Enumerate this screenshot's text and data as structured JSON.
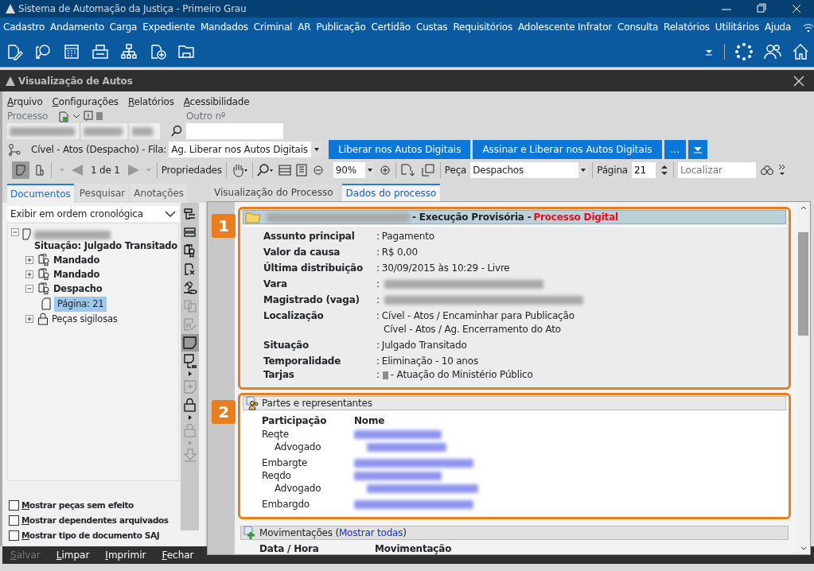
{
  "window": {
    "title": "Sistema de Automação da Justiça - Primeiro Grau"
  },
  "app_menu": [
    "Cadastro",
    "Andamento",
    "Carga",
    "Expediente",
    "Mandados",
    "Criminal",
    "AR",
    "Publicação",
    "Certidão",
    "Custas",
    "Requisitórios",
    "Adolescente Infrator",
    "Consulta",
    "Relatórios",
    "Utilitários",
    "Ajuda"
  ],
  "child_window": {
    "title": "Visualização de Autos"
  },
  "child_menu": [
    "Arquivo",
    "Configurações",
    "Relatórios",
    "Acessibilidade"
  ],
  "process_fields": {
    "processo_label": "Processo",
    "outro_label": "Outro nº"
  },
  "queue": {
    "label": "Cível - Atos (Despacho) - Fila:",
    "value": "Ag. Liberar nos Autos Digitais",
    "buttons": [
      "Liberar nos Autos Digitais",
      "Assinar e Liberar nos Autos Digitais",
      "..."
    ]
  },
  "doc_toolbar": {
    "page_counter": "1 de 1",
    "properties": "Propriedades",
    "zoom": "90%",
    "peca_label": "Peça",
    "peca_value": "Despachos",
    "pagina_label": "Página",
    "pagina_value": "21",
    "search_placeholder": "Localizar"
  },
  "left_tabs": [
    {
      "label": "Documentos",
      "selected": true
    },
    {
      "label": "Pesquisar",
      "selected": false
    },
    {
      "label": "Anotações",
      "selected": false
    }
  ],
  "order_select": "Exibir em ordem cronológica",
  "tree": {
    "status": "Situação: Julgado Transitado",
    "expanded": true,
    "children": [
      {
        "label": "Mandado",
        "kind": "seal",
        "expanded": false,
        "bold": true,
        "selected": false
      },
      {
        "label": "Mandado",
        "kind": "seal",
        "expanded": false,
        "bold": true,
        "selected": false
      },
      {
        "label": "Despacho",
        "kind": "seal",
        "expanded": true,
        "bold": true,
        "selected": false,
        "children": [
          {
            "label": "Página: 21",
            "kind": "page",
            "selected": true
          }
        ]
      },
      {
        "label": "Peças sigilosas",
        "kind": "lock",
        "expanded": false,
        "bold": false,
        "selected": false
      }
    ]
  },
  "side_tools": [
    {
      "kind": "tree",
      "disabled": false,
      "selected": false
    },
    {
      "kind": "layout",
      "disabled": false,
      "selected": false
    },
    {
      "kind": "seal",
      "disabled": false,
      "selected": false
    },
    {
      "kind": "docx",
      "disabled": false,
      "selected": false
    },
    {
      "kind": "gavel",
      "disabled": false,
      "selected": false
    },
    {
      "kind": "copy",
      "disabled": true,
      "selected": false
    },
    {
      "kind": "sign",
      "disabled": true,
      "selected": false
    },
    {
      "kind": "note",
      "disabled": false,
      "selected": true
    },
    {
      "kind": "notetree",
      "disabled": false,
      "selected": false
    },
    {
      "kind": "add",
      "disabled": true,
      "selected": false
    },
    {
      "kind": "lock",
      "disabled": false,
      "selected": false
    },
    {
      "kind": "lock",
      "disabled": true,
      "selected": false
    },
    {
      "kind": "download",
      "disabled": true,
      "selected": false
    }
  ],
  "options": [
    {
      "label": "Mostrar peças sem efeito",
      "checked": false
    },
    {
      "label": "Mostrar dependentes arquivados",
      "checked": false
    },
    {
      "label": "Mostrar tipo de documento SAJ",
      "checked": false
    }
  ],
  "bottom_buttons": [
    {
      "label": "Salvar",
      "disabled": true
    },
    {
      "label": "Limpar",
      "disabled": false
    },
    {
      "label": "Imprimir",
      "disabled": false
    },
    {
      "label": "Fechar",
      "disabled": false
    }
  ],
  "right_tabs": [
    {
      "label": "Visualização do Processo",
      "selected": false
    },
    {
      "label": "Dados do processo",
      "selected": true
    }
  ],
  "process_section": {
    "callout": "1",
    "separator": ":",
    "title": "- Execução Provisória -",
    "status": "Processo Digital",
    "fields": [
      {
        "label": "Assunto principal",
        "kind": "text",
        "values": [
          "Pagamento"
        ]
      },
      {
        "label": "Valor da causa",
        "kind": "text",
        "values": [
          "R$ 0,00"
        ]
      },
      {
        "label": "Última distribuição",
        "kind": "text",
        "values": [
          "30/09/2015 às 10:29 - Livre"
        ]
      },
      {
        "label": "Vara",
        "kind": "redacted"
      },
      {
        "label": "Magistrado (vaga)",
        "kind": "redacted"
      },
      {
        "label": "Localização",
        "kind": "text",
        "values": [
          "Cível - Atos / Encaminhar para Publicação",
          "Cível - Atos / Ag. Encerramento do Ato"
        ]
      },
      {
        "label": "Situação",
        "kind": "text",
        "values": [
          "Julgado Transitado"
        ]
      },
      {
        "label": "Temporalidade",
        "kind": "text",
        "values": [
          "Eliminação - 10 anos"
        ]
      },
      {
        "label": "Tarjas",
        "kind": "tag",
        "color": "#8c8c8c",
        "values": [
          "- Atuação do Ministério Público"
        ]
      }
    ]
  },
  "parties_section": {
    "callout": "2",
    "title": "Partes e representantes",
    "columns": [
      "Participação",
      "Nome"
    ],
    "rows": [
      {
        "role": "Reqte",
        "children": [
          {
            "role": "Advogado"
          }
        ]
      },
      {
        "role": "Embargte",
        "children": []
      },
      {
        "role": "Reqdo",
        "children": [
          {
            "role": "Advogado"
          }
        ]
      },
      {
        "role": "Embargdo",
        "children": []
      }
    ]
  },
  "movements_section": {
    "title": "Movimentações (",
    "link": "Mostrar todas",
    "title_end": ")",
    "columns": [
      "Data / Hora",
      "Movimentação"
    ]
  }
}
